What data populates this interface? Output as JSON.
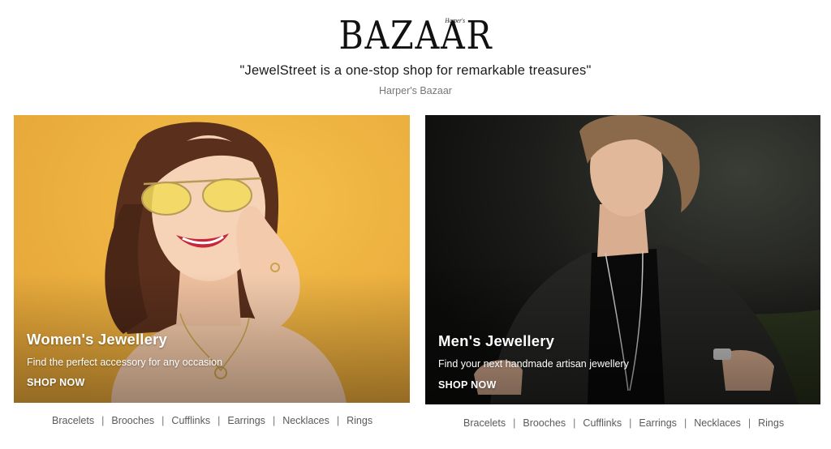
{
  "header": {
    "logo_small": "Harper's",
    "logo_text": "BAZAAR",
    "quote": "\"JewelStreet is a one-stop shop for remarkable treasures\"",
    "quote_source": "Harper's Bazaar"
  },
  "cards": [
    {
      "title": "Women's Jewellery",
      "subtitle": "Find the perfect accessory for any occasion",
      "cta": "SHOP NOW"
    },
    {
      "title": "Men's Jewellery",
      "subtitle": "Find your next handmade artisan jewellery",
      "cta": "SHOP NOW"
    }
  ],
  "women_categories": [
    "Bracelets",
    "Brooches",
    "Cufflinks",
    "Earrings",
    "Necklaces",
    "Rings"
  ],
  "men_categories": [
    "Bracelets",
    "Brooches",
    "Cufflinks",
    "Earrings",
    "Necklaces",
    "Rings"
  ],
  "separator": "|",
  "colors": {
    "women_card_bg": "#eeb03d",
    "men_card_bg": "#1a1b18",
    "link_text": "#5a5a5a"
  }
}
